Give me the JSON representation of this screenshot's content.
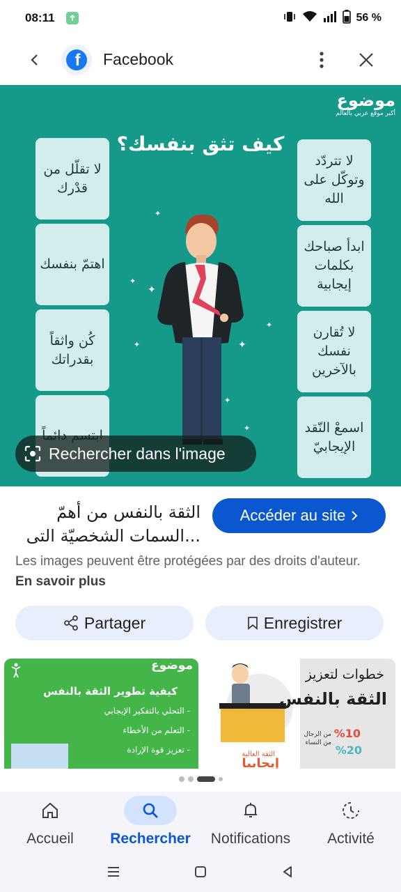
{
  "status": {
    "time": "08:11",
    "battery": "56 %"
  },
  "top_bar": {
    "title": "Facebook",
    "logo_letter": "f"
  },
  "image": {
    "brand_name": "موضوع",
    "brand_tagline": "أكبر موقع عربي بالعالم",
    "heading": "كيف تثق بنفسك؟",
    "tips_left": [
      "لا تقلّل من قدْرك",
      "اهتمّ بنفسك",
      "كُن واثقاً بقدراتك",
      "ابتسم دائماً"
    ],
    "tips_right": [
      "لا تتردّد وتوكّل على الله",
      "ابدأ صباحك بكلمات إيجابية",
      "لا تُقارن نفسك بالآخرين",
      "اسمعْ النّقد الإيجابيّ"
    ],
    "search_label": "Rechercher dans l'image"
  },
  "result": {
    "title": "الثقة بالنفس من أهمّ السمات الشخصيّة التى...",
    "visit_button": "Accéder au site",
    "copyright": "Les images peuvent être protégées par des droits d'auteur.",
    "learn_more": "En savoir plus",
    "share_button": "Partager",
    "save_button": "Enregistrer"
  },
  "related": [
    {
      "brand": "موضوع",
      "title": "كيفية تطوير الثقة بالنفس",
      "items": [
        "- التحلي بالتفكير الإيجابي",
        "- التعلم من الأخطاء",
        "- تعزيز قوة الإرادة"
      ]
    },
    {
      "title_line1": "خطوات لتعزيز",
      "title_line2": "الثقة بالنفس",
      "stat1": "%10",
      "stat2": "%20",
      "stat_label1": "من الرجال",
      "stat_label2": "من النساء",
      "poster_caption": "الثقة العالية",
      "poster_word": "إيجابيا"
    }
  ],
  "bottom_nav": [
    {
      "label": "Accueil",
      "icon": "home-icon",
      "active": false
    },
    {
      "label": "Rechercher",
      "icon": "search-icon",
      "active": true
    },
    {
      "label": "Notifications",
      "icon": "bell-icon",
      "active": false
    },
    {
      "label": "Activité",
      "icon": "activity-icon",
      "active": false
    }
  ]
}
